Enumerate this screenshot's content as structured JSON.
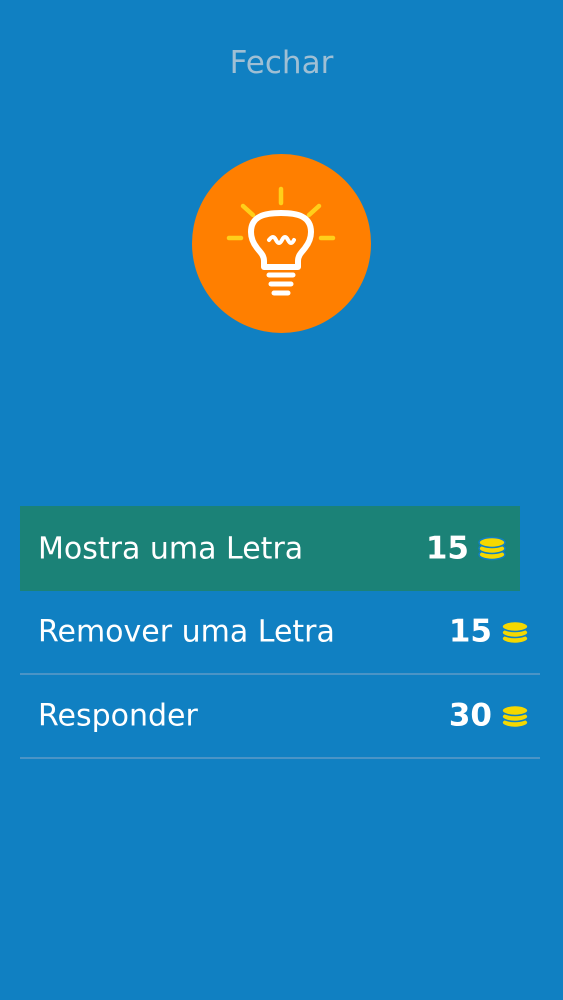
{
  "header": {
    "close_label": "Fechar"
  },
  "hint_icon": "lightbulb-icon",
  "colors": {
    "background": "#1080c2",
    "circle": "#ff7f00",
    "selected_row": "#1b8277",
    "coin": "#f5d800",
    "rays": "#ffcf1a"
  },
  "menu": {
    "items": [
      {
        "label": "Mostra uma Letra",
        "cost": "15",
        "icon": "coin-stack-icon",
        "selected": true
      },
      {
        "label": "Remover uma Letra",
        "cost": "15",
        "icon": "coin-stack-icon",
        "selected": false
      },
      {
        "label": "Responder",
        "cost": "30",
        "icon": "coin-stack-icon",
        "selected": false
      }
    ]
  }
}
